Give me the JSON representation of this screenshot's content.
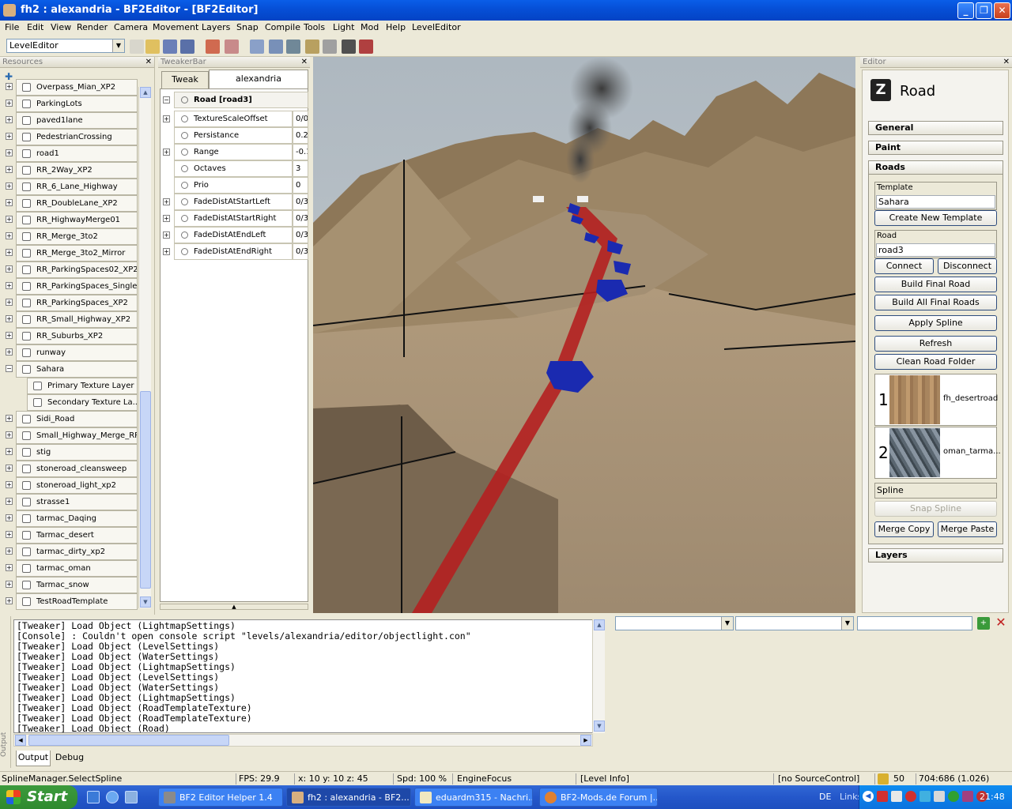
{
  "window": {
    "title": "fh2 : alexandria - BF2Editor - [BF2Editor]"
  },
  "menu": [
    "File",
    "Edit",
    "View",
    "Render",
    "Camera",
    "Movement",
    "Layers",
    "Snap",
    "Compile",
    "Tools",
    "Light",
    "Mod",
    "Help",
    "LevelEditor"
  ],
  "toolbar": {
    "editor_select": "LevelEditor"
  },
  "resources": {
    "title": "Resources",
    "items": [
      {
        "label": "Overpass_Mian_XP2",
        "pm": "+"
      },
      {
        "label": "ParkingLots",
        "pm": "+"
      },
      {
        "label": "paved1lane",
        "pm": "+"
      },
      {
        "label": "PedestrianCrossing",
        "pm": "+"
      },
      {
        "label": "road1",
        "pm": "+"
      },
      {
        "label": "RR_2Way_XP2",
        "pm": "+"
      },
      {
        "label": "RR_6_Lane_Highway",
        "pm": "+"
      },
      {
        "label": "RR_DoubleLane_XP2",
        "pm": "+"
      },
      {
        "label": "RR_HighwayMerge01",
        "pm": "+"
      },
      {
        "label": "RR_Merge_3to2",
        "pm": "+"
      },
      {
        "label": "RR_Merge_3to2_Mirror",
        "pm": "+"
      },
      {
        "label": "RR_ParkingSpaces02_XP2",
        "pm": "+"
      },
      {
        "label": "RR_ParkingSpaces_Single...",
        "pm": "+"
      },
      {
        "label": "RR_ParkingSpaces_XP2",
        "pm": "+"
      },
      {
        "label": "RR_Small_Highway_XP2",
        "pm": "+"
      },
      {
        "label": "RR_Suburbs_XP2",
        "pm": "+"
      },
      {
        "label": "runway",
        "pm": "+"
      },
      {
        "label": "Sahara",
        "pm": "-"
      },
      {
        "label": "Primary Texture Layer",
        "child": true
      },
      {
        "label": "Secondary Texture La...",
        "child": true
      },
      {
        "label": "Sidi_Road",
        "pm": "+"
      },
      {
        "label": "Small_Highway_Merge_RR...",
        "pm": "+"
      },
      {
        "label": "stig",
        "pm": "+"
      },
      {
        "label": "stoneroad_cleansweep",
        "pm": "+"
      },
      {
        "label": "stoneroad_light_xp2",
        "pm": "+"
      },
      {
        "label": "strasse1",
        "pm": "+"
      },
      {
        "label": "tarmac_Daqing",
        "pm": "+"
      },
      {
        "label": "Tarmac_desert",
        "pm": "+"
      },
      {
        "label": "tarmac_dirty_xp2",
        "pm": "+"
      },
      {
        "label": "tarmac_oman",
        "pm": "+"
      },
      {
        "label": "Tarmac_snow",
        "pm": "+"
      },
      {
        "label": "TestRoadTemplate",
        "pm": "+"
      }
    ]
  },
  "tweaker": {
    "title": "TweakerBar",
    "tabs": [
      "Tweak",
      "alexandria"
    ],
    "object": "Road [road3]",
    "rows": [
      {
        "name": "TextureScaleOffset",
        "value": "0/0",
        "pm": "+"
      },
      {
        "name": "Persistance",
        "value": "0.2",
        "pm": ""
      },
      {
        "name": "Range",
        "value": "-0.1",
        "pm": "+"
      },
      {
        "name": "Octaves",
        "value": "3",
        "pm": ""
      },
      {
        "name": "Prio",
        "value": "0",
        "pm": ""
      },
      {
        "name": "FadeDistAtStartLeft",
        "value": "0/3",
        "pm": "+"
      },
      {
        "name": "FadeDistAtStartRight",
        "value": "0/3",
        "pm": "+"
      },
      {
        "name": "FadeDistAtEndLeft",
        "value": "0/3",
        "pm": "+"
      },
      {
        "name": "FadeDistAtEndRight",
        "value": "0/3",
        "pm": "+"
      }
    ]
  },
  "editor": {
    "title": "Editor",
    "heading": "Road",
    "sections": {
      "general": "General",
      "paint": "Paint",
      "roads": "Roads",
      "layers": "Layers"
    },
    "template_label": "Template",
    "template_value": "Sahara",
    "create_template": "Create New Template",
    "road_label": "Road",
    "road_value": "road3",
    "connect": "Connect",
    "disconnect": "Disconnect",
    "build_final": "Build Final Road",
    "build_all": "Build All Final Roads",
    "apply_spline": "Apply Spline",
    "refresh": "Refresh",
    "clean_folder": "Clean Road Folder",
    "textures": [
      {
        "num": "1",
        "name": "fh_desertroad"
      },
      {
        "num": "2",
        "name": "oman_tarma..."
      }
    ],
    "spline_label": "Spline",
    "snap_spline": "Snap Spline",
    "merge_copy": "Merge Copy",
    "merge_paste": "Merge Paste"
  },
  "output": {
    "side_label": "Output",
    "lines": [
      "[Tweaker] Load Object (LightmapSettings)",
      "[Console] : Couldn't open console script \"levels/alexandria/editor/objectlight.con\"",
      "[Tweaker] Load Object (LevelSettings)",
      "[Tweaker] Load Object (WaterSettings)",
      "[Tweaker] Load Object (LightmapSettings)",
      "[Tweaker] Load Object (LevelSettings)",
      "[Tweaker] Load Object (WaterSettings)",
      "[Tweaker] Load Object (LightmapSettings)",
      "[Tweaker] Load Object (RoadTemplateTexture)",
      "[Tweaker] Load Object (RoadTemplateTexture)",
      "[Tweaker] Load Object (Road)"
    ],
    "tabs": [
      "Output",
      "Debug"
    ]
  },
  "status": {
    "action": "SplineManager.SelectSpline",
    "fps": "FPS: 29.9",
    "coords": "x: 10 y: 10 z: 45",
    "speed": "Spd: 100 %",
    "focus": "EngineFocus",
    "level": "[Level Info]",
    "source": "[no SourceControl]",
    "volume": "50",
    "res": "704:686 (1.026)"
  },
  "taskbar": {
    "start": "Start",
    "tasks": [
      "BF2 Editor Helper 1.4",
      "fh2 : alexandria - BF2...",
      "eduardm315 - Nachri...",
      "BF2-Mods.de Forum |..."
    ],
    "lang": "DE",
    "links": "Links",
    "clock": "21:48"
  }
}
